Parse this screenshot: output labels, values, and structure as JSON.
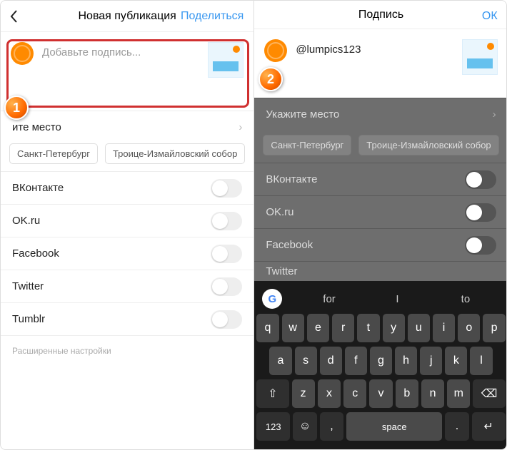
{
  "left": {
    "header": {
      "title": "Новая публикация",
      "action": "Поделиться"
    },
    "caption_placeholder": "Добавьте подпись...",
    "location_row": "ите место",
    "chips": [
      "Санкт-Петербург",
      "Троице-Измайловский собор"
    ],
    "shares": [
      "ВКонтакте",
      "OK.ru",
      "Facebook",
      "Twitter",
      "Tumblr"
    ],
    "advanced": "Расширенные настройки"
  },
  "right": {
    "header": {
      "title": "Подпись",
      "action": "ОК"
    },
    "caption_value": "@lumpics123",
    "location_row": "Укажите место",
    "chips": [
      "Санкт-Петербург",
      "Троице-Измайловский собор"
    ],
    "shares": [
      "ВКонтакте",
      "OK.ru",
      "Facebook",
      "Twitter"
    ],
    "keyboard": {
      "suggestions": [
        "for",
        "I",
        "to"
      ],
      "row1": [
        "q",
        "w",
        "e",
        "r",
        "t",
        "y",
        "u",
        "i",
        "o",
        "p"
      ],
      "row2": [
        "a",
        "s",
        "d",
        "f",
        "g",
        "h",
        "j",
        "k",
        "l"
      ],
      "row3": [
        "z",
        "x",
        "c",
        "v",
        "b",
        "n",
        "m"
      ],
      "shift": "⇧",
      "backspace": "⌫",
      "numbers": "123",
      "emoji": "☺",
      "comma": ",",
      "space": "space",
      "period": ".",
      "enter": "↵"
    }
  },
  "badges": {
    "one": "1",
    "two": "2"
  }
}
